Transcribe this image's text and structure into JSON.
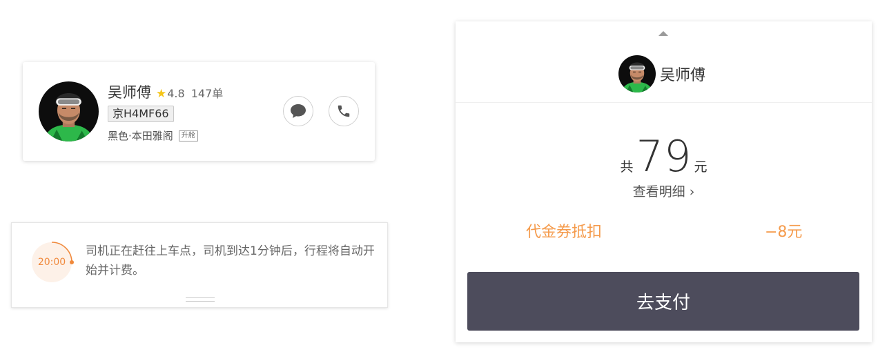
{
  "driver_card": {
    "name": "吴师傅",
    "rating": "4.8",
    "orders": "147单",
    "plate": "京H4MF66",
    "car": "黑色·本田雅阁",
    "car_tag": "升舱",
    "icons": {
      "message": "chat-bubble-icon",
      "call": "phone-icon",
      "rating": "star-icon"
    }
  },
  "status_card": {
    "timer": "20:00",
    "message": "司机正在赶往上车点，司机到达1分钟后，行程将自动开始并计费。"
  },
  "payment": {
    "driver_name": "吴师傅",
    "total_prefix": "共",
    "total_amount": "79",
    "total_unit": "元",
    "detail_link": "查看明细 ›",
    "coupon_label": "代金券抵扣",
    "coupon_value": "−8元",
    "pay_button": "去支付"
  },
  "colors": {
    "accent_orange": "#f59b4c",
    "timer_orange": "#f0893c",
    "button_dark": "#4d4c5c",
    "star_yellow": "#f5c518"
  }
}
